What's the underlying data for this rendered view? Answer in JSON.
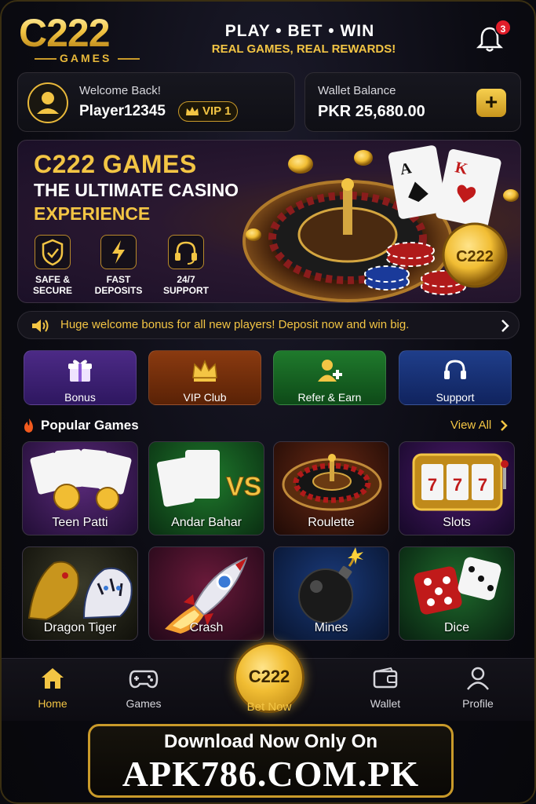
{
  "brand": {
    "logo_main": "C222",
    "logo_sub": "GAMES"
  },
  "header": {
    "tagline_title": "PLAY • BET • WIN",
    "tagline_sub": "REAL GAMES, REAL REWARDS!",
    "notification_count": "3"
  },
  "user": {
    "welcome": "Welcome Back!",
    "name": "Player12345",
    "vip": "VIP 1"
  },
  "wallet": {
    "label": "Wallet Balance",
    "amount": "PKR 25,680.00",
    "add_label": "+"
  },
  "banner": {
    "title": "C222 GAMES",
    "subtitle_1": "THE ULTIMATE CASINO",
    "subtitle_2": "EXPERIENCE",
    "features": [
      {
        "label_1": "SAFE &",
        "label_2": "SECURE",
        "icon": "shield-icon"
      },
      {
        "label_1": "FAST",
        "label_2": "DEPOSITS",
        "icon": "lightning-icon"
      },
      {
        "label_1": "24/7",
        "label_2": "SUPPORT",
        "icon": "headset-icon"
      }
    ],
    "chip_text": "C222"
  },
  "announcement": {
    "text": "Huge welcome bonus for all new players! Deposit now and win big."
  },
  "quick_actions": [
    {
      "label": "Bonus",
      "icon": "gift-icon"
    },
    {
      "label": "VIP Club",
      "icon": "crown-icon"
    },
    {
      "label": "Refer & Earn",
      "icon": "add-user-icon"
    },
    {
      "label": "Support",
      "icon": "headset-icon"
    }
  ],
  "popular": {
    "title": "Popular Games",
    "view_all": "View All",
    "games": [
      {
        "label": "Teen Patti"
      },
      {
        "label": "Andar Bahar"
      },
      {
        "label": "Roulette"
      },
      {
        "label": "Slots"
      },
      {
        "label": "Dragon Tiger"
      },
      {
        "label": "Crash"
      },
      {
        "label": "Mines"
      },
      {
        "label": "Dice"
      }
    ]
  },
  "nav": {
    "home": "Home",
    "games": "Games",
    "bet_now_coin": "C222",
    "bet_now": "Bet Now",
    "wallet": "Wallet",
    "profile": "Profile"
  },
  "download": {
    "line_1": "Download Now Only On",
    "line_2": "APK786.COM.PK"
  },
  "colors": {
    "gold": "#f3c544",
    "background": "#0a0a0f",
    "alert": "#e11d2a"
  }
}
